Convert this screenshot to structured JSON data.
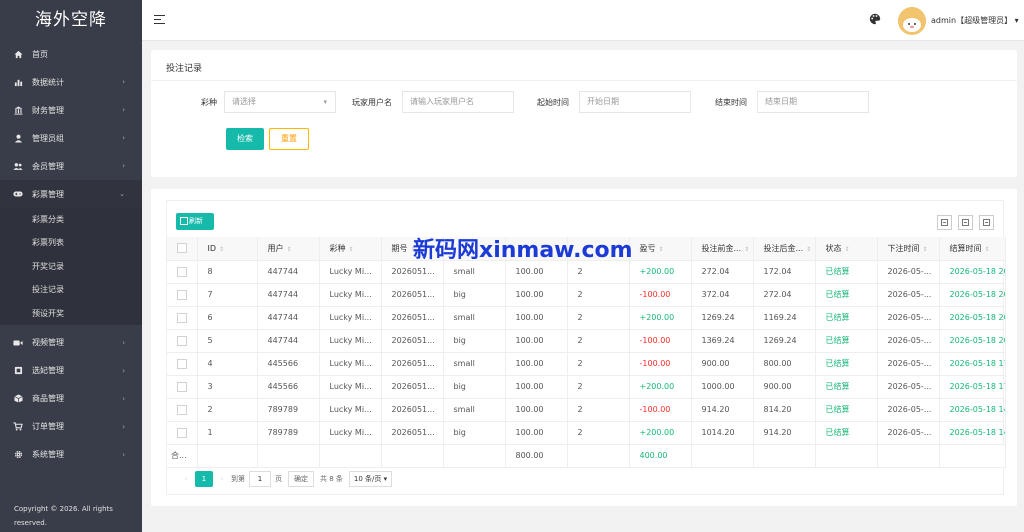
{
  "sidebar": {
    "brand": "海外空降",
    "items": [
      {
        "icon": "home-icon",
        "label": "首页",
        "arrow": ""
      },
      {
        "icon": "bar-chart-icon",
        "label": "数据统计",
        "arrow": "›"
      },
      {
        "icon": "bank-icon",
        "label": "财务管理",
        "arrow": "›"
      },
      {
        "icon": "user-icon",
        "label": "管理员组",
        "arrow": "›"
      },
      {
        "icon": "users-icon",
        "label": "会员管理",
        "arrow": "›"
      },
      {
        "icon": "gamepad-icon",
        "label": "彩票管理",
        "arrow": "⌄"
      }
    ],
    "submenu": [
      "彩票分类",
      "彩票列表",
      "开奖记录",
      "投注记录",
      "预设开奖"
    ],
    "items_after": [
      {
        "icon": "video-icon",
        "label": "视频管理",
        "arrow": "›"
      },
      {
        "icon": "ticket-icon",
        "label": "选妃管理",
        "arrow": "›"
      },
      {
        "icon": "box-icon",
        "label": "商品管理",
        "arrow": "›"
      },
      {
        "icon": "cart-icon",
        "label": "订单管理",
        "arrow": "›"
      },
      {
        "icon": "gear-icon",
        "label": "系统管理",
        "arrow": "›"
      }
    ],
    "footer": "Copyright © 2026. All rights reserved."
  },
  "topbar": {
    "user": "admin【超级管理员】",
    "user_caret": "▾"
  },
  "search": {
    "title": "投注记录",
    "lottery_label": "彩种",
    "lottery_placeholder": "请选择",
    "player_label": "玩家用户名",
    "player_placeholder": "请输入玩家用户名",
    "start_label": "起始时间",
    "start_placeholder": "开始日期",
    "end_label": "结束时间",
    "end_placeholder": "结束日期",
    "search_button": "检索",
    "reset_button": "重置"
  },
  "table": {
    "refresh_label": "刷新",
    "columns": [
      "ID",
      "用户",
      "彩种",
      "期号",
      "",
      "",
      "",
      "盈亏",
      "投注前金...",
      "投注后金...",
      "状态",
      "下注时间",
      "结算时间"
    ],
    "rows": [
      {
        "id": "8",
        "user": "447744",
        "lottery": "Lucky Mi...",
        "issue": "2026051...",
        "bet": "small",
        "amount": "100.00",
        "mult": "2",
        "profit": "+200.00",
        "before": "272.04",
        "after": "172.04",
        "status": "已结算",
        "bet_time": "2026-05-...",
        "settle_time": "2026-05-18 20"
      },
      {
        "id": "7",
        "user": "447744",
        "lottery": "Lucky Mi...",
        "issue": "2026051...",
        "bet": "big",
        "amount": "100.00",
        "mult": "2",
        "profit": "-100.00",
        "before": "372.04",
        "after": "272.04",
        "status": "已结算",
        "bet_time": "2026-05-...",
        "settle_time": "2026-05-18 20"
      },
      {
        "id": "6",
        "user": "447744",
        "lottery": "Lucky Mi...",
        "issue": "2026051...",
        "bet": "small",
        "amount": "100.00",
        "mult": "2",
        "profit": "+200.00",
        "before": "1269.24",
        "after": "1169.24",
        "status": "已结算",
        "bet_time": "2026-05-...",
        "settle_time": "2026-05-18 20"
      },
      {
        "id": "5",
        "user": "447744",
        "lottery": "Lucky Mi...",
        "issue": "2026051...",
        "bet": "big",
        "amount": "100.00",
        "mult": "2",
        "profit": "-100.00",
        "before": "1369.24",
        "after": "1269.24",
        "status": "已结算",
        "bet_time": "2026-05-...",
        "settle_time": "2026-05-18 20"
      },
      {
        "id": "4",
        "user": "445566",
        "lottery": "Lucky Mi...",
        "issue": "2026051...",
        "bet": "small",
        "amount": "100.00",
        "mult": "2",
        "profit": "-100.00",
        "before": "900.00",
        "after": "800.00",
        "status": "已结算",
        "bet_time": "2026-05-...",
        "settle_time": "2026-05-18 17"
      },
      {
        "id": "3",
        "user": "445566",
        "lottery": "Lucky Mi...",
        "issue": "2026051...",
        "bet": "big",
        "amount": "100.00",
        "mult": "2",
        "profit": "+200.00",
        "before": "1000.00",
        "after": "900.00",
        "status": "已结算",
        "bet_time": "2026-05-...",
        "settle_time": "2026-05-18 17"
      },
      {
        "id": "2",
        "user": "789789",
        "lottery": "Lucky Mi...",
        "issue": "2026051...",
        "bet": "small",
        "amount": "100.00",
        "mult": "2",
        "profit": "-100.00",
        "before": "914.20",
        "after": "814.20",
        "status": "已结算",
        "bet_time": "2026-05-...",
        "settle_time": "2026-05-18 14"
      },
      {
        "id": "1",
        "user": "789789",
        "lottery": "Lucky Mi...",
        "issue": "2026051...",
        "bet": "big",
        "amount": "100.00",
        "mult": "2",
        "profit": "+200.00",
        "before": "1014.20",
        "after": "914.20",
        "status": "已结算",
        "bet_time": "2026-05-...",
        "settle_time": "2026-05-18 14"
      }
    ],
    "total_label": "合...",
    "total_amount": "800.00",
    "total_profit": "400.00"
  },
  "pager": {
    "current": "1",
    "goto_label": "到第",
    "page_input": "1",
    "page_unit": "页",
    "confirm": "确定",
    "total": "共 8 条",
    "per_page": "10 条/页"
  },
  "watermark": "新码网xinmaw.com",
  "colors": {
    "accent": "#16baaa",
    "profit_positive": "#16b777",
    "profit_negative": "#ff2a2a",
    "sidebar": "#393d49"
  }
}
